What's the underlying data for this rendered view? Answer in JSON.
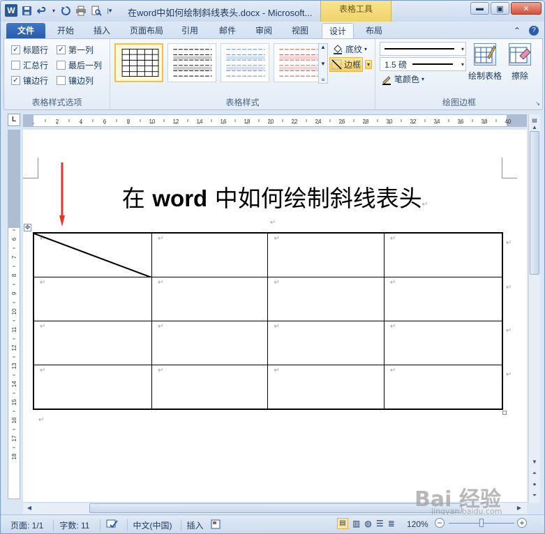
{
  "window": {
    "title": "在word中如何绘制斜线表头.docx  -  Microsoft...",
    "context_tab": "表格工具",
    "buttons": {
      "minimize": "▬",
      "maximize": "▣",
      "close": "✕"
    }
  },
  "tabs": [
    "文件",
    "开始",
    "插入",
    "页面布局",
    "引用",
    "邮件",
    "审阅",
    "视图",
    "设计",
    "布局"
  ],
  "active_tab": "设计",
  "ribbon": {
    "style_options": {
      "label": "表格样式选项",
      "items": [
        {
          "label": "标题行",
          "checked": true
        },
        {
          "label": "第一列",
          "checked": true
        },
        {
          "label": "汇总行",
          "checked": false
        },
        {
          "label": "最后一列",
          "checked": false
        },
        {
          "label": "镶边行",
          "checked": true
        },
        {
          "label": "镶边列",
          "checked": false
        }
      ]
    },
    "table_styles": {
      "label": "表格样式",
      "shading": "底纹",
      "borders": "边框"
    },
    "draw_borders": {
      "label": "绘图边框",
      "pen_weight": "1.5 磅",
      "pen_color": "笔颜色",
      "draw_table": "绘制表格",
      "eraser": "擦除"
    }
  },
  "ruler": {
    "h_labels": [
      "2",
      "4",
      "6",
      "8",
      "10",
      "12",
      "14",
      "16",
      "18",
      "20",
      "22",
      "24",
      "26",
      "28",
      "30",
      "32",
      "34",
      "36",
      "38",
      "40"
    ],
    "v_labels": [
      "1",
      "2",
      "3",
      "4",
      "5",
      "6",
      "7",
      "8",
      "9",
      "10",
      "11",
      "12",
      "13",
      "14",
      "15",
      "16",
      "17",
      "18"
    ]
  },
  "document": {
    "title_prefix": "在 ",
    "title_bold": "word",
    "title_suffix": " 中如何绘制斜线表头",
    "para_mark": "↵"
  },
  "status": {
    "page": "页面: 1/1",
    "words": "字数: 11",
    "language": "中文(中国)",
    "insert": "插入",
    "zoom": "120%"
  },
  "watermark": {
    "text": "Bai 经验",
    "url": "jingyan.baidu.com"
  },
  "colors": {
    "accent": "#2a5caa",
    "context": "#f1d36a",
    "arrow": "#e8322c"
  }
}
